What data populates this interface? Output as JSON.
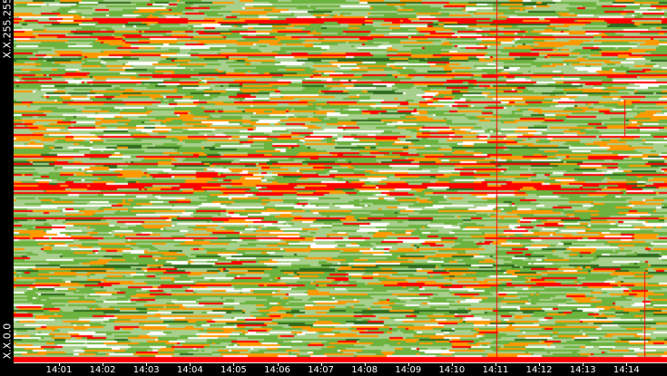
{
  "chart_data": {
    "type": "heatmap",
    "title": "",
    "xlabel": "",
    "ylabel": "",
    "y_tick_labels": [
      "X.X.255.255",
      "X.X.0.0"
    ],
    "x_tick_labels": [
      "14:01",
      "14:02",
      "14:03",
      "14:04",
      "14:05",
      "14:06",
      "14:07",
      "14:08",
      "14:09",
      "14:10",
      "14:11",
      "14:12",
      "14:13",
      "14:14"
    ],
    "x_range": [
      "14:00",
      "14:14:45"
    ],
    "y_range": [
      "X.X.0.0",
      "X.X.255.255"
    ],
    "highlight_time": "14:11",
    "palette": {
      "low": "#ffffff",
      "mid_low": "#a8d08d",
      "mid": "#6cb33f",
      "high": "#ff9900",
      "max": "#ff0000",
      "dark": "#2f6b1f"
    }
  }
}
